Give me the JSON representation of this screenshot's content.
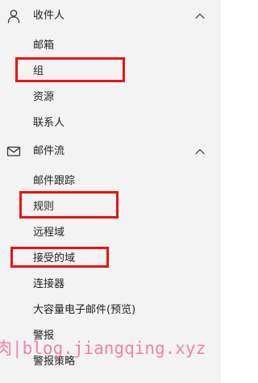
{
  "nav": {
    "recipients": {
      "label": "收件人",
      "icon": "person-icon",
      "chevron_icon": "chevron-up-icon",
      "items": [
        "邮箱",
        "组",
        "资源",
        "联系人"
      ]
    },
    "mail_flow": {
      "label": "邮件流",
      "icon": "mail-icon",
      "chevron_icon": "chevron-up-icon",
      "items": [
        "邮件跟踪",
        "规则",
        "远程域",
        "接受的域",
        "连接器",
        "大容量电子邮件(预览)",
        "警报",
        "警报策略"
      ]
    }
  },
  "watermark": {
    "text": "肉|blog.jiangqing.xyz"
  },
  "colors": {
    "panel_background": "#f3f3f3",
    "highlight_border": "#ee1111",
    "watermark_text": "#f06fa5"
  }
}
